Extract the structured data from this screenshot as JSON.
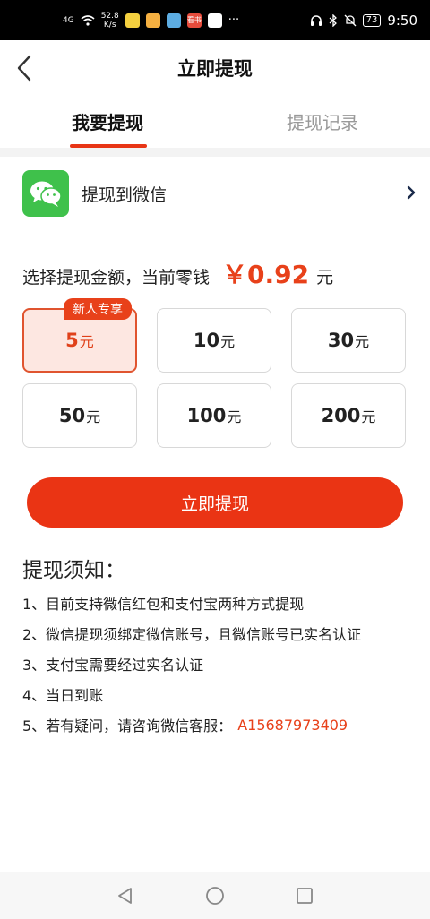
{
  "status_bar": {
    "network": "4G",
    "speed_value": "52.8",
    "speed_unit": "K/s",
    "battery": "73",
    "time": "9:50",
    "more": "···",
    "app_icon_label": "看书"
  },
  "header": {
    "title": "立即提现"
  },
  "tabs": [
    {
      "label": "我要提现",
      "active": true
    },
    {
      "label": "提现记录",
      "active": false
    }
  ],
  "wechat": {
    "label": "提现到微信"
  },
  "amount": {
    "prompt": "选择提现金额，当前零钱",
    "value": "￥0.92",
    "unit": "元"
  },
  "options": [
    {
      "value": "5",
      "unit": "元",
      "badge": "新人专享",
      "selected": true
    },
    {
      "value": "10",
      "unit": "元"
    },
    {
      "value": "30",
      "unit": "元"
    },
    {
      "value": "50",
      "unit": "元"
    },
    {
      "value": "100",
      "unit": "元"
    },
    {
      "value": "200",
      "unit": "元"
    }
  ],
  "submit_label": "立即提现",
  "notes": {
    "title": "提现须知：",
    "items": [
      "1、目前支持微信红包和支付宝两种方式提现",
      "2、微信提现须绑定微信账号，且微信账号已实名认证",
      "3、支付宝需要经过实名认证",
      "4、当日到账",
      "5、若有疑问，请咨询微信客服："
    ],
    "contact": "A15687973409"
  },
  "colors": {
    "accent": "#ea3414",
    "wechat_green": "#3fc14b",
    "selected_bg": "#fde7e1"
  }
}
